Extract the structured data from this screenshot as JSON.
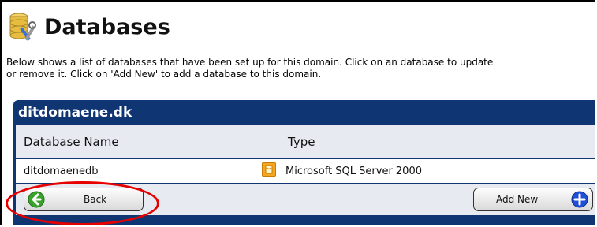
{
  "page": {
    "title": "Databases",
    "description_line1": "Below shows a list of databases that have been set up for this domain. Click on an database to update",
    "description_line2": "or remove it. Click on 'Add New' to add a database to this domain."
  },
  "panel": {
    "domain": "ditdomaene.dk",
    "columns": [
      "Database Name",
      "Type"
    ],
    "rows": [
      {
        "name": "ditdomaenedb",
        "type": "Microsoft SQL Server 2000",
        "type_icon": "sql-server-icon"
      }
    ]
  },
  "buttons": {
    "back_label": "Back",
    "add_new_label": "Add New"
  },
  "icons": {
    "title_icon": "database-tools-icon",
    "back_icon": "arrow-left-icon",
    "add_icon": "plus-icon"
  },
  "colors": {
    "panel_header_bg": "#0f3573",
    "panel_row_bg": "#e7eaf1",
    "back_icon_green": "#3aa22c",
    "add_icon_blue": "#1f4fd6",
    "highlight_red": "#e60000"
  }
}
